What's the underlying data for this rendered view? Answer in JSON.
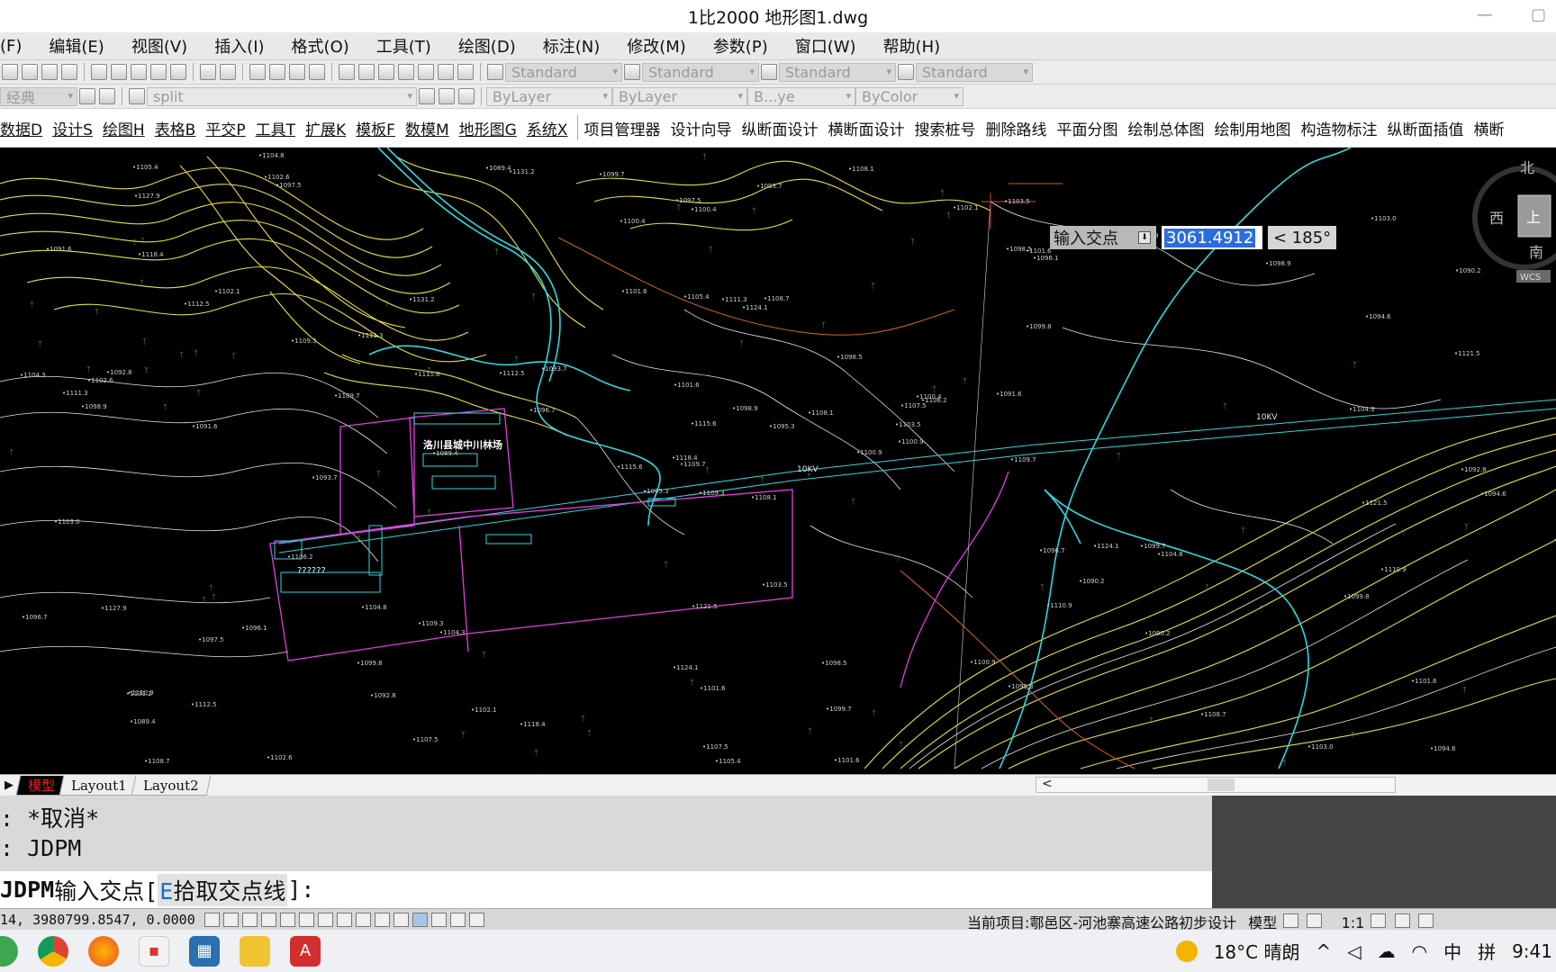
{
  "window": {
    "title": "1比2000 地形图1.dwg"
  },
  "menus": [
    "(F)",
    "编辑(E)",
    "视图(V)",
    "插入(I)",
    "格式(O)",
    "工具(T)",
    "绘图(D)",
    "标注(N)",
    "修改(M)",
    "参数(P)",
    "窗口(W)",
    "帮助(H)"
  ],
  "toolbar1": {
    "styles": [
      "Standard",
      "Standard",
      "Standard",
      "Standard"
    ]
  },
  "toolbar2": {
    "workspace": "经典",
    "layer": "split",
    "color": "ByLayer",
    "linetype": "ByLayer",
    "lineweight": "B...ye",
    "plotstyle": "ByColor"
  },
  "ribbon": {
    "underlined": [
      "数据D",
      "设计S",
      "绘图H",
      "表格B",
      "平交P",
      "工具T",
      "扩展K",
      "模板F",
      "数模M",
      "地形图G",
      "系统X"
    ],
    "plain": [
      "项目管理器",
      "设计向导",
      "纵断面设计",
      "横断面设计",
      "搜索桩号",
      "删除路线",
      "平面分图",
      "绘制总体图",
      "绘制用地图",
      "构造物标注",
      "纵断面插值",
      "横断"
    ]
  },
  "drawing": {
    "map_labels": [
      "洛川县城中川林场",
      "10KV",
      "10KV",
      "??????"
    ],
    "spot_heights": [
      "1108.1",
      "1112.5",
      "1109.7",
      "1110.9",
      "1107.5",
      "1104.3",
      "1103.5",
      "1108.7",
      "1101.6",
      "1100.9",
      "1097.5",
      "1094.6",
      "1091.6",
      "1090.2",
      "1095.3",
      "1099.8",
      "1102.6",
      "1105.4",
      "1098.5",
      "1096.1",
      "1093.7",
      "1089.4",
      "1092.8",
      "1111.3",
      "1106.2",
      "1104.8",
      "1102.1",
      "1100.4",
      "1098.9",
      "1096.7",
      "1121.5",
      "1118.4",
      "1124.1",
      "1115.6",
      "1131.2",
      "1127.9",
      "1109.3",
      "1103.0",
      "1101.6",
      "1099.7"
    ],
    "dynamic_input": {
      "prompt": "输入交点",
      "value": "3061.4912",
      "angle": "< 185°"
    },
    "viewcube": {
      "north": "北",
      "west": "西",
      "south": "南",
      "top": "上",
      "wcs": "WCS"
    }
  },
  "layout_tabs": {
    "tabs": [
      "模型",
      "Layout1",
      "Layout2"
    ],
    "active": "模型",
    "scroll_arrow": "<"
  },
  "command": {
    "history": [
      ": *取消*",
      ": JDPM"
    ],
    "prompt_cmd": "JDPM",
    "prompt_text": " 输入交点[",
    "option_key": "E",
    "option_text": "拾取交点线",
    "prompt_end": "]:"
  },
  "status": {
    "coords": "14, 3980799.8547, 0.0000",
    "project": "当前项目:鄠邑区-河池寨高速公路初步设计",
    "model": "模型",
    "scale": "1:1"
  },
  "taskbar": {
    "weather": "18°C 晴朗",
    "ime1": "中",
    "ime2": "拼",
    "time": "9:41"
  },
  "colors": {
    "contour_yellow": "#e8e040",
    "contour_white": "#e8e8e8",
    "road_cyan": "#2fd8e0",
    "boundary_magenta": "#e040e0",
    "orange_line": "#c86020",
    "vegetation": "#40c040"
  }
}
